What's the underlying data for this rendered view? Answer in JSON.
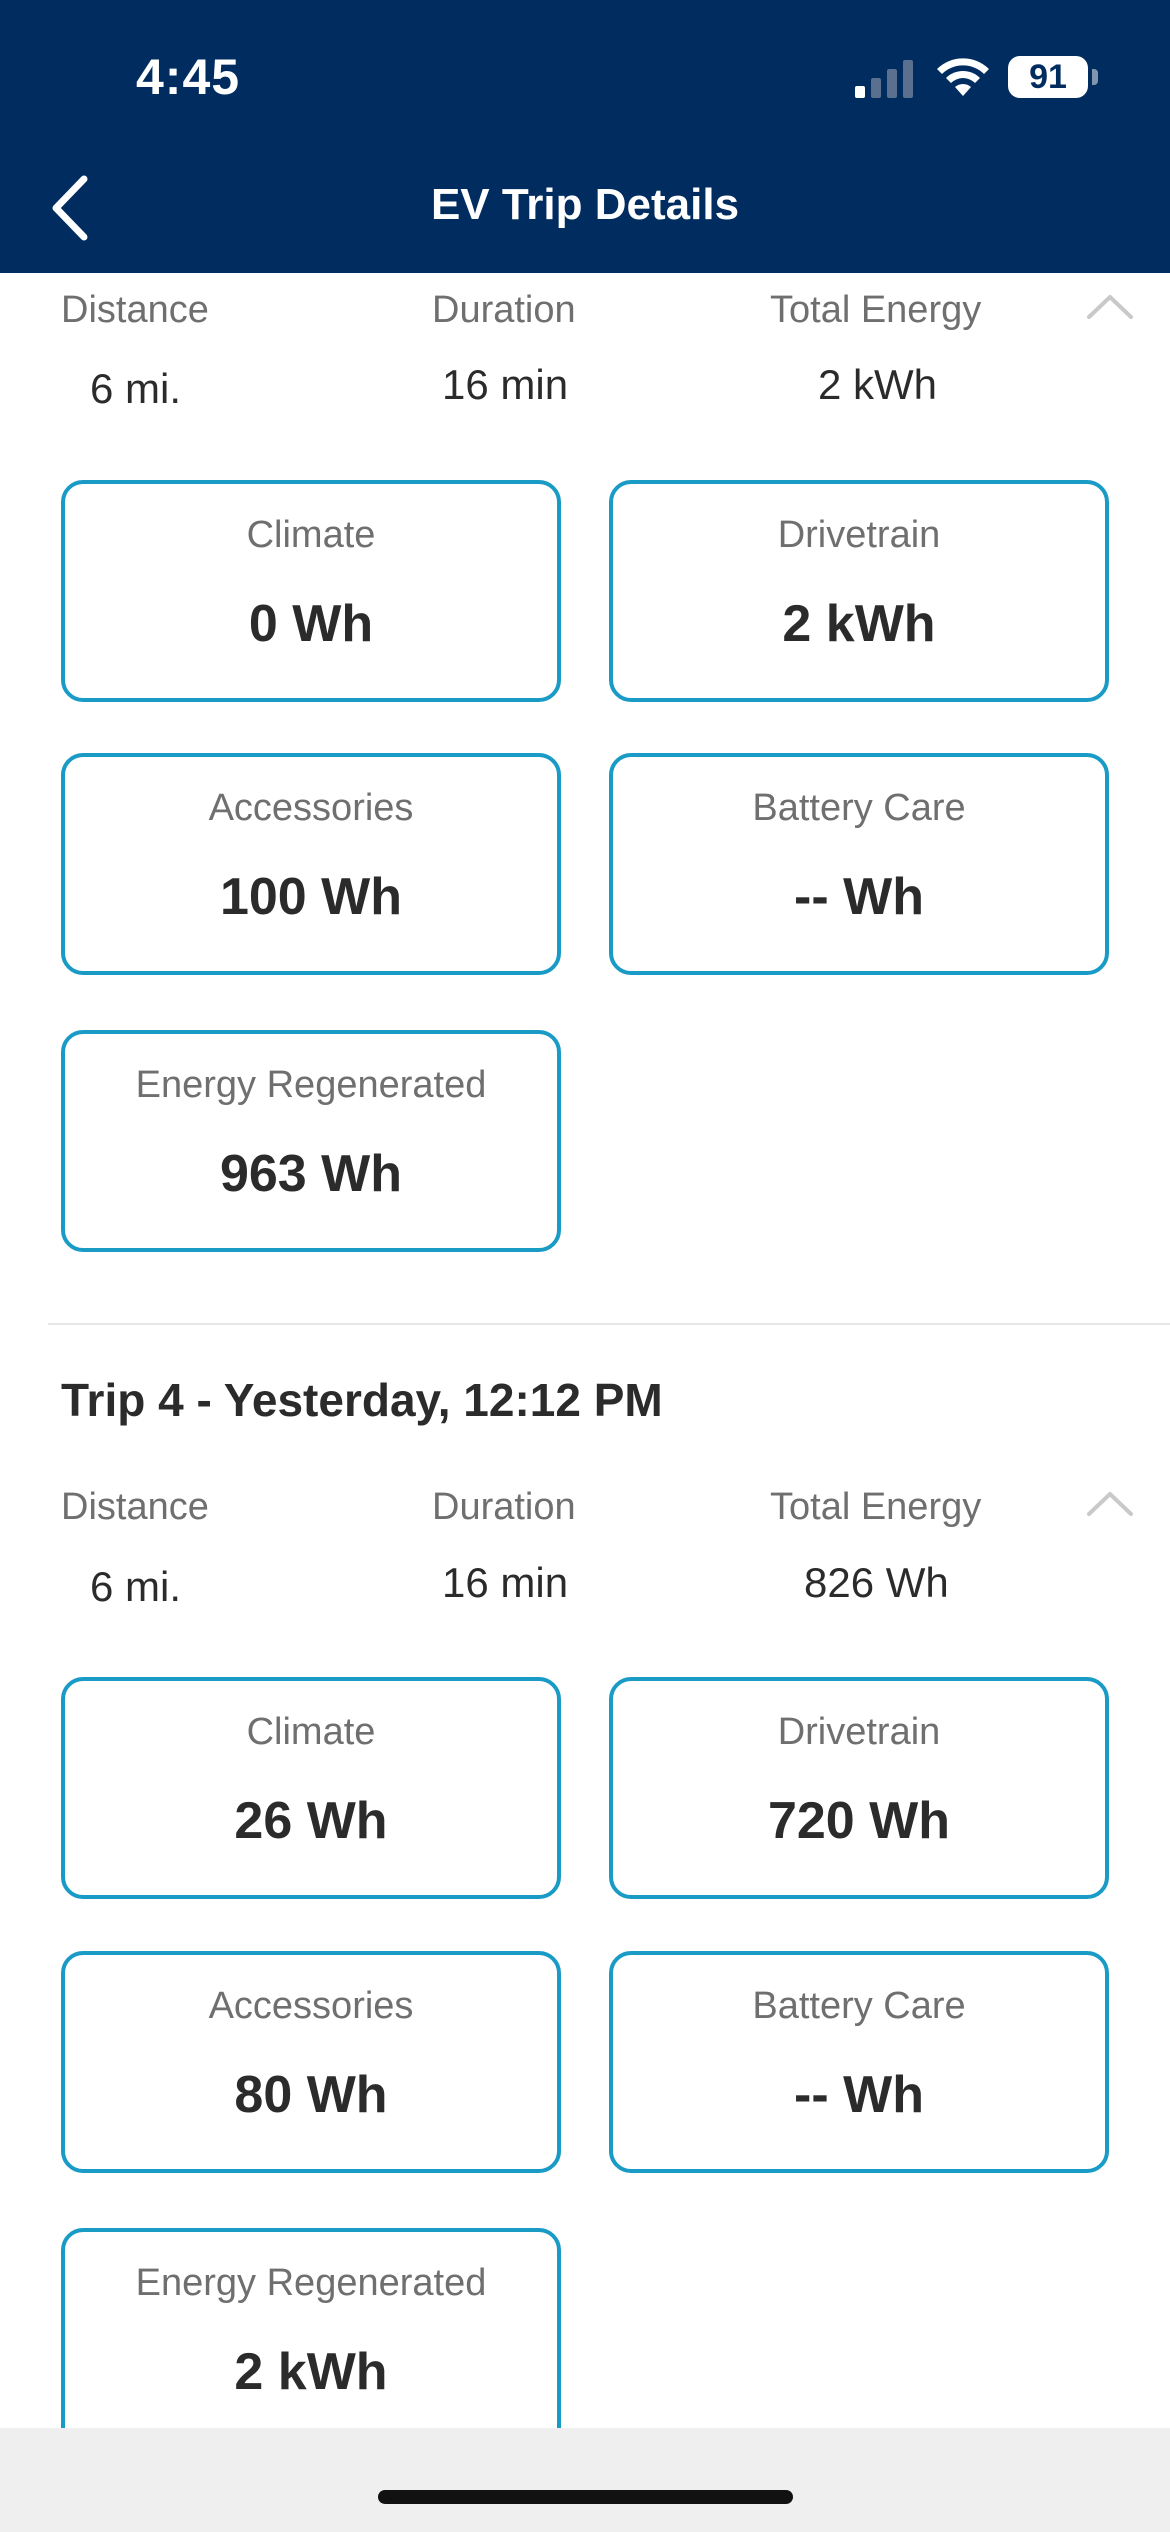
{
  "status_bar": {
    "time": "4:45",
    "battery": "91"
  },
  "nav": {
    "title": "EV Trip Details"
  },
  "trips": [
    {
      "title": "",
      "stats": {
        "distance_label": "Distance",
        "distance_value": "6 mi.",
        "duration_label": "Duration",
        "duration_value": "16 min",
        "energy_label": "Total Energy",
        "energy_value": "2 kWh"
      },
      "cards": [
        {
          "label": "Climate",
          "value": "0 Wh"
        },
        {
          "label": "Drivetrain",
          "value": "2 kWh"
        },
        {
          "label": "Accessories",
          "value": "100 Wh"
        },
        {
          "label": "Battery Care",
          "value": "-- Wh"
        },
        {
          "label": "Energy Regenerated",
          "value": "963 Wh"
        }
      ]
    },
    {
      "title": "Trip 4 - Yesterday, 12:12 PM",
      "stats": {
        "distance_label": "Distance",
        "distance_value": "6 mi.",
        "duration_label": "Duration",
        "duration_value": "16 min",
        "energy_label": "Total Energy",
        "energy_value": "826 Wh"
      },
      "cards": [
        {
          "label": "Climate",
          "value": "26 Wh"
        },
        {
          "label": "Drivetrain",
          "value": "720 Wh"
        },
        {
          "label": "Accessories",
          "value": "80 Wh"
        },
        {
          "label": "Battery Care",
          "value": "-- Wh"
        },
        {
          "label": "Energy Regenerated",
          "value": "2 kWh"
        }
      ]
    }
  ],
  "colors": {
    "header": "#002c5f",
    "card_border": "#1a9bc6",
    "text": "#2b2b2b",
    "label": "#6f6f6f"
  }
}
